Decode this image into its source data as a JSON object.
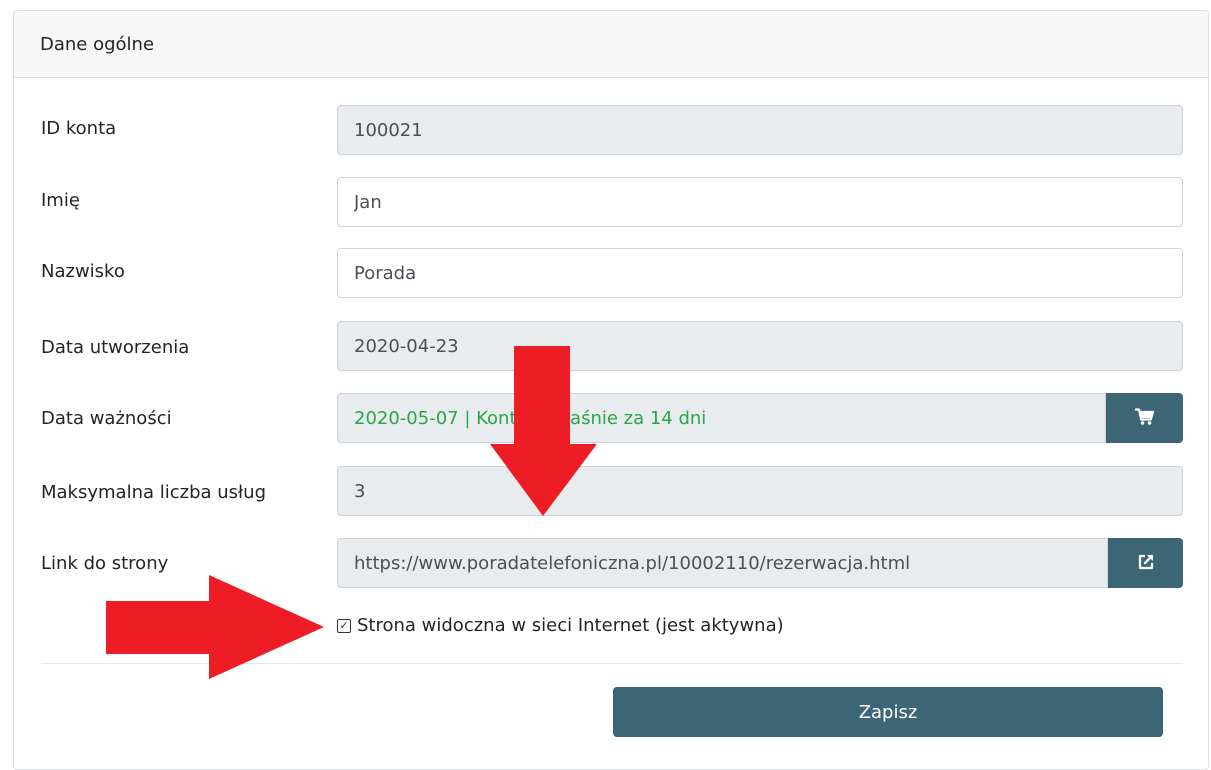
{
  "card": {
    "title": "Dane ogólne"
  },
  "fields": {
    "account_id": {
      "label": "ID konta",
      "value": "100021"
    },
    "first_name": {
      "label": "Imię",
      "value": "Jan"
    },
    "last_name": {
      "label": "Nazwisko",
      "value": "Porada"
    },
    "created": {
      "label": "Data utworzenia",
      "value": "2020-04-23"
    },
    "expiry": {
      "label": "Data ważności",
      "value": "2020-05-07 | Konto wygaśnie za 14 dni"
    },
    "max_services": {
      "label": "Maksymalna liczba usług",
      "value": "3"
    },
    "site_link": {
      "label": "Link do strony",
      "value": "https://www.poradatelefoniczna.pl/10002110/rezerwacja.html"
    }
  },
  "checkbox": {
    "label": "Strona widoczna w sieci Internet (jest aktywna)",
    "checked": true
  },
  "buttons": {
    "save": "Zapisz"
  },
  "icons": {
    "cart": "shopping-cart-icon",
    "external": "external-link-icon"
  },
  "colors": {
    "accent": "#3c6676",
    "success_text": "#28a745",
    "arrow": "#ee1c25"
  }
}
